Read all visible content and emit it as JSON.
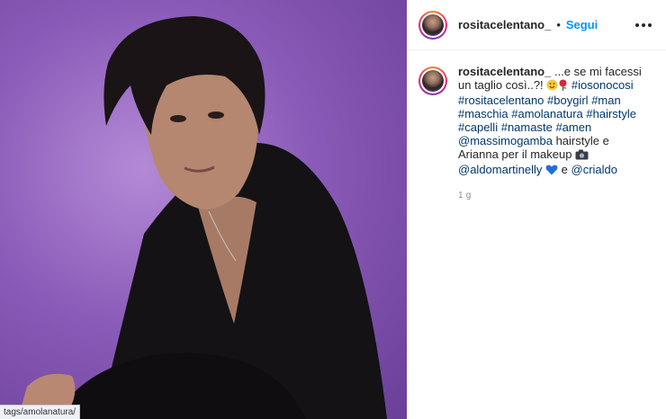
{
  "header": {
    "username": "rositacelentano_",
    "separator": "•",
    "follow_label": "Segui"
  },
  "caption": {
    "username": "rositacelentano_",
    "text_1": "...e se mi facessi un taglio così..?!",
    "tags_1": [
      "#iosonocosi",
      "#rositacelentano",
      "#boygirl",
      "#man",
      "#maschia",
      "#amolanatura",
      "#hairstyle",
      "#capelli",
      "#namaste",
      "#amen"
    ],
    "mention_1": "@massimogamba",
    "text_2": "hairstyle e Arianna per il makeup",
    "mention_2": "@aldomartinelly",
    "text_3": "e",
    "mention_3": "@crialdo",
    "time": "1 g"
  },
  "status_bar": {
    "url": "tags/amolanatura/"
  },
  "colors": {
    "link": "#00376b",
    "follow": "#0095f6",
    "background": "#6a3f98"
  },
  "icons": [
    "smiling-face-emoji",
    "rose-emoji",
    "camera-emoji",
    "blue-heart-emoji",
    "more-options-icon"
  ]
}
